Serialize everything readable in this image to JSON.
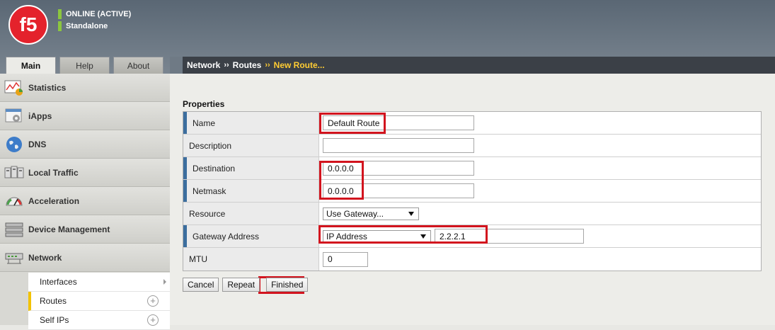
{
  "header": {
    "logo_text": "f5",
    "status_line1": "ONLINE (ACTIVE)",
    "status_line2": "Standalone",
    "status_color": "#8cc63f"
  },
  "tabs": [
    {
      "label": "Main",
      "active": true
    },
    {
      "label": "Help",
      "active": false
    },
    {
      "label": "About",
      "active": false
    }
  ],
  "breadcrumb": {
    "items": [
      "Network",
      "Routes",
      "New Route..."
    ],
    "separator": "››",
    "current_color": "#ffcc33"
  },
  "sidebar": {
    "items": [
      {
        "label": "Statistics",
        "icon": "statistics-chart-icon"
      },
      {
        "label": "iApps",
        "icon": "iapps-gear-icon"
      },
      {
        "label": "DNS",
        "icon": "globe-icon"
      },
      {
        "label": "Local Traffic",
        "icon": "local-traffic-icon"
      },
      {
        "label": "Acceleration",
        "icon": "speedometer-icon"
      },
      {
        "label": "Device Management",
        "icon": "server-stack-icon"
      },
      {
        "label": "Network",
        "icon": "network-switch-icon"
      }
    ],
    "sub_items": [
      {
        "label": "Interfaces",
        "has_arrow": true
      },
      {
        "label": "Routes",
        "active": true,
        "has_plus": true
      },
      {
        "label": "Self IPs",
        "has_plus": true
      }
    ]
  },
  "form": {
    "section_title": "Properties",
    "rows": {
      "name": {
        "label": "Name",
        "value": "Default Route"
      },
      "description": {
        "label": "Description",
        "value": ""
      },
      "destination": {
        "label": "Destination",
        "value": "0.0.0.0"
      },
      "netmask": {
        "label": "Netmask",
        "value": "0.0.0.0"
      },
      "resource": {
        "label": "Resource",
        "selected": "Use Gateway..."
      },
      "gateway": {
        "label": "Gateway Address",
        "type_selected": "IP Address",
        "value": "2.2.2.1"
      },
      "mtu": {
        "label": "MTU",
        "value": "0"
      }
    }
  },
  "buttons": {
    "cancel": "Cancel",
    "repeat": "Repeat",
    "finished": "Finished"
  },
  "highlight_color": "#d2141e",
  "required_marker_color": "#3c6e9e"
}
